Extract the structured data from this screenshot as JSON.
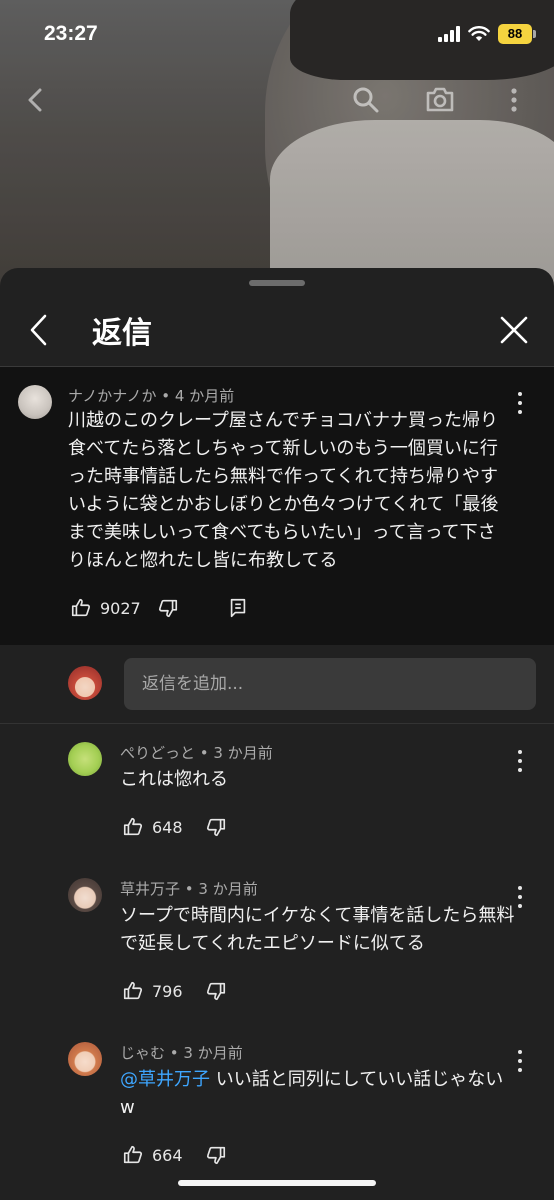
{
  "status_bar": {
    "time": "23:27",
    "battery": "88"
  },
  "sheet": {
    "title": "返信"
  },
  "parent_comment": {
    "author": "ナノかナノか",
    "age": "4 か月前",
    "text": "川越のこのクレープ屋さんでチョコバナナ買った帰り食べてたら落としちゃって新しいのもう一個買いに行った時事情話したら無料で作ってくれて持ち帰りやすいように袋とかおしぼりとか色々つけてくれて「最後まで美味しいって食べてもらいたい」って言って下さりほんと惚れたし皆に布教してる",
    "likes": "9027"
  },
  "add_reply": {
    "placeholder": "返信を追加..."
  },
  "replies": [
    {
      "author": "ぺりどっと",
      "age": "3 か月前",
      "text": "これは惚れる",
      "likes": "648"
    },
    {
      "author": "草井万子",
      "age": "3 か月前",
      "text": "ソープで時間内にイケなくて事情を話したら無料で延長してくれたエピソードに似てる",
      "likes": "796"
    },
    {
      "author": "じゃむ",
      "age": "3 か月前",
      "mention": "@草井万子",
      "text": "いい話と同列にしていい話じゃないw",
      "likes": "664"
    }
  ],
  "colors": {
    "sheet_bg": "#212121",
    "parent_bg": "#121212",
    "mention": "#3ea6ff",
    "battery": "#f5d33f"
  }
}
